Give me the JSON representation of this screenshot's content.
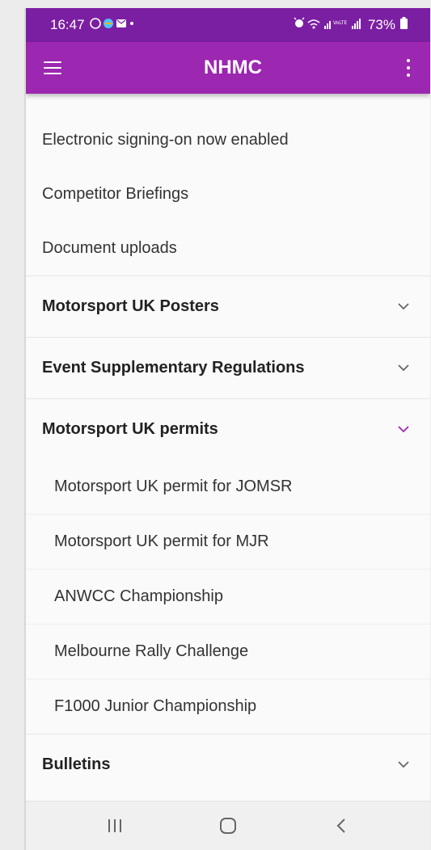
{
  "status_bar": {
    "time": "16:47",
    "notification_icons": "notification-icons",
    "right_icons": "alarm-wifi-signal-icons",
    "battery": "73%"
  },
  "app_bar": {
    "title": "NHMC",
    "left_icon": "hamburger-menu-icon",
    "right_icon": "more-vert-icon",
    "color": "#9c27b0",
    "status_color": "#7b1fa2"
  },
  "links": [
    {
      "label": "Electronic signing-on now enabled"
    },
    {
      "label": "Competitor Briefings"
    },
    {
      "label": "Document uploads"
    }
  ],
  "sections": [
    {
      "label": "Motorsport UK Posters",
      "expanded": false
    },
    {
      "label": "Event Supplementary Regulations",
      "expanded": false
    },
    {
      "label": "Motorsport UK permits",
      "expanded": true,
      "items": [
        {
          "label": "Motorsport UK permit for JOMSR"
        },
        {
          "label": "Motorsport UK permit for MJR"
        },
        {
          "label": "ANWCC Championship"
        },
        {
          "label": "Melbourne Rally Challenge"
        },
        {
          "label": "F1000 Junior Championship"
        }
      ]
    },
    {
      "label": "Bulletins",
      "expanded": false
    }
  ],
  "nav_bar": {
    "recents_icon": "recents-icon",
    "home_icon": "home-icon",
    "back_icon": "back-icon"
  },
  "colors": {
    "accent": "#9c27b0",
    "chevron_collapsed": "#666666"
  }
}
